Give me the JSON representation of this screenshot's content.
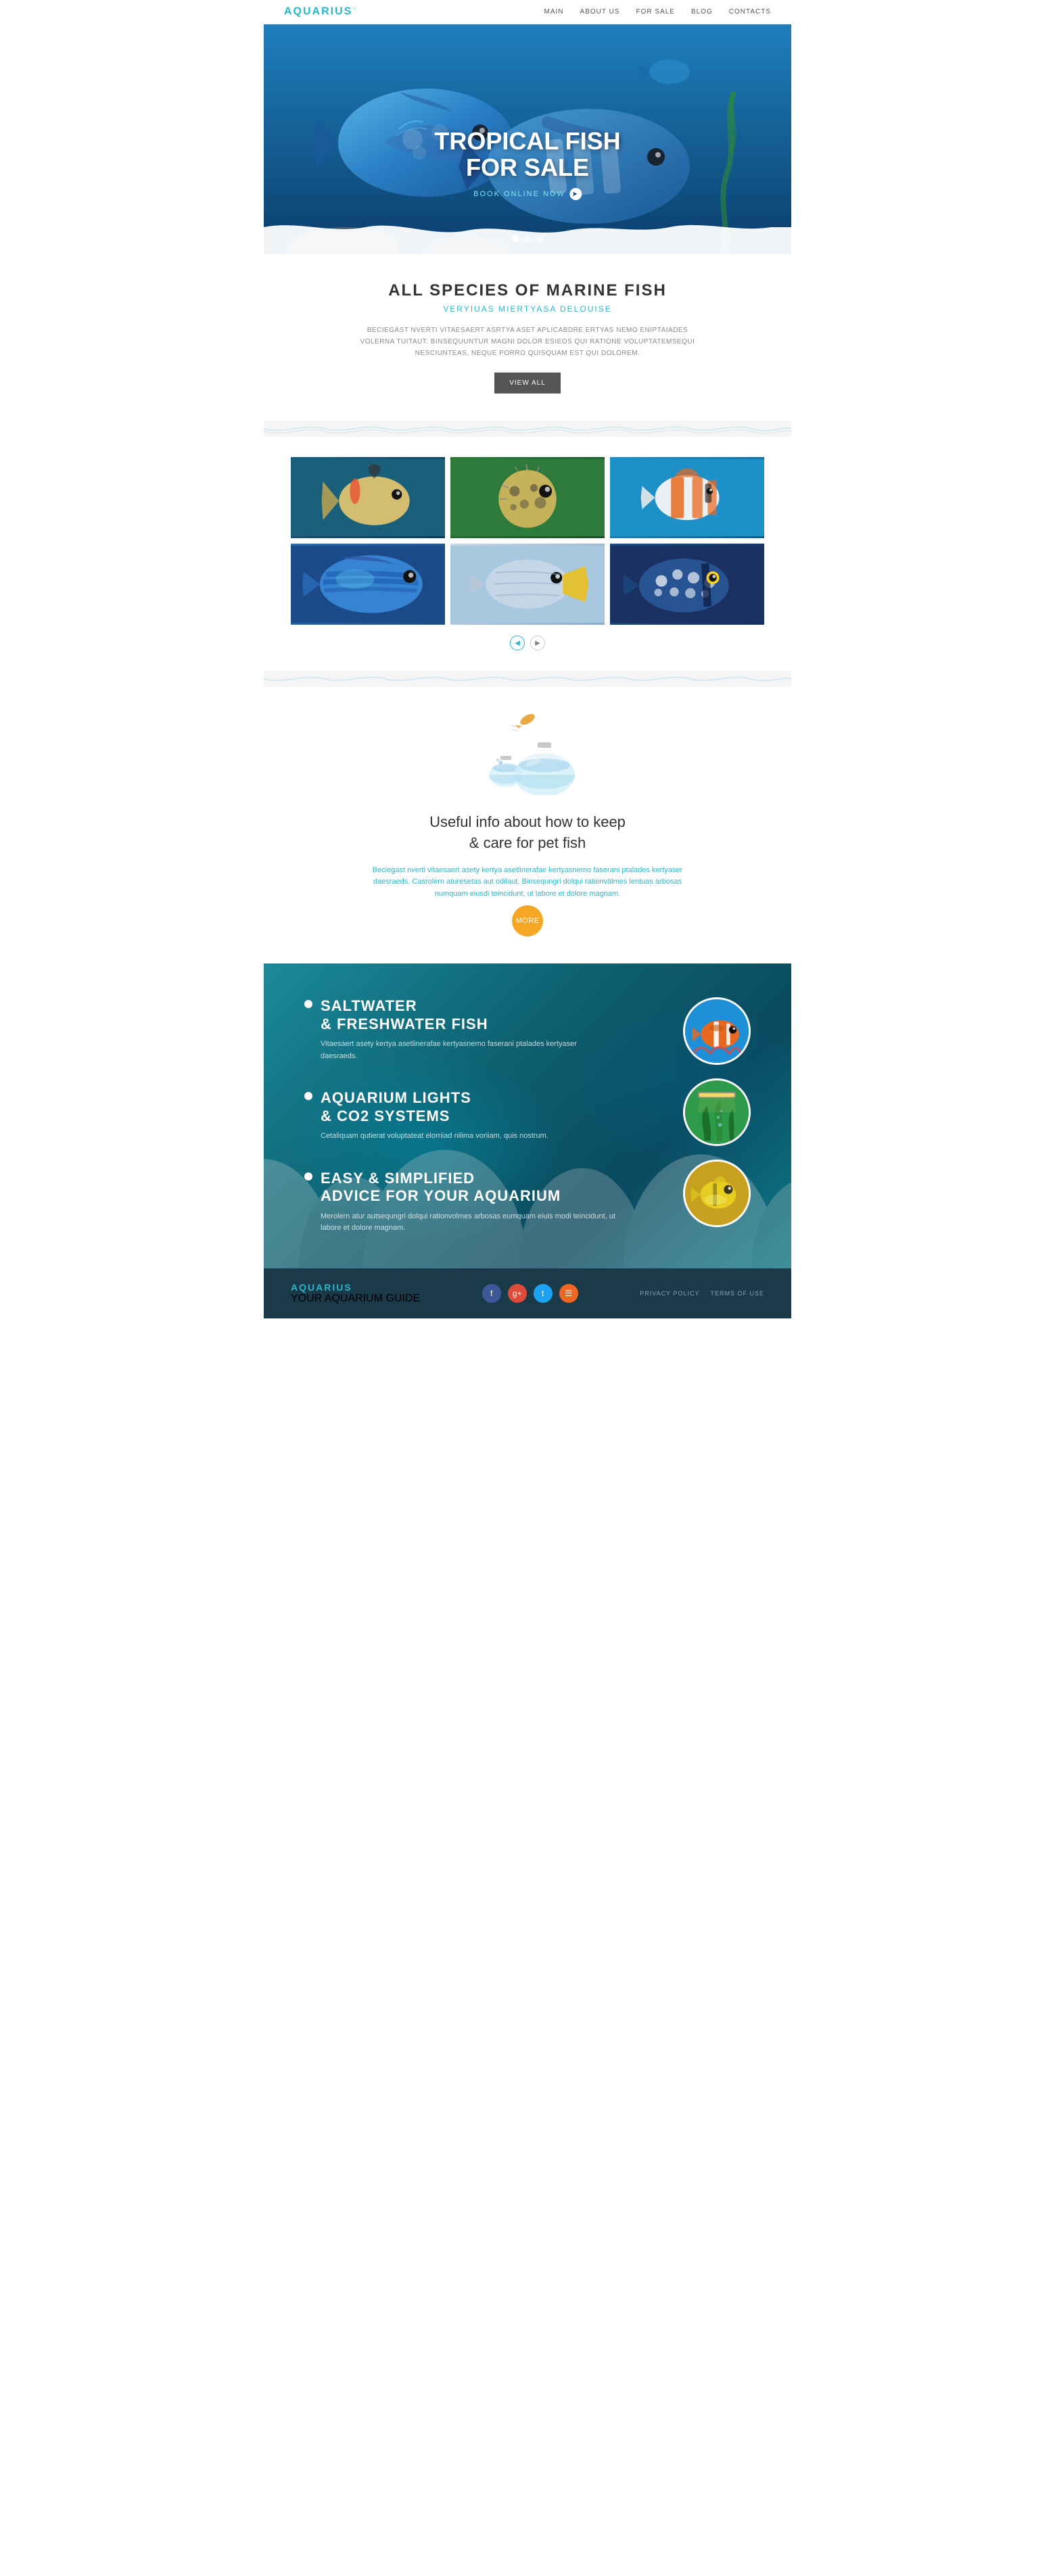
{
  "header": {
    "logo": "AQUARIUS",
    "nav": [
      {
        "label": "MAIN",
        "href": "#"
      },
      {
        "label": "ABOUT US",
        "href": "#"
      },
      {
        "label": "FOR SALE",
        "href": "#"
      },
      {
        "label": "BLOG",
        "href": "#"
      },
      {
        "label": "CONTACTS",
        "href": "#"
      }
    ]
  },
  "hero": {
    "title_line1": "TROPICAL FISH",
    "title_line2": "FOR SALE",
    "cta": "BOOK ONLINE NOW",
    "dots": [
      true,
      false,
      false
    ]
  },
  "species": {
    "heading": "ALL SPECIES OF MARINE FISH",
    "subtitle": "VERYIUAS MIERTYASA DELOUISE",
    "body": "BECIEGAST NVERTI VITAESAERT ASRTYA ASET APLICABDRE ERTYAS NEMO ENIPTAIADES VOLERNA TUITAUT. BINSEQUUNTUR MAGNI DOLOR ESIEOS QUI RATIONE VOLUPTATEMSEQUI NESCIUNTEAS, NEQUE PORRO QUISQUAM EST QUI DOLOREM.",
    "view_all_btn": "VIEW ALL"
  },
  "gallery": {
    "fish": [
      {
        "emoji": "🐟",
        "class": "fish1"
      },
      {
        "emoji": "🐡",
        "class": "fish2"
      },
      {
        "emoji": "🐠",
        "class": "fish3"
      },
      {
        "emoji": "🐟",
        "class": "fish4"
      },
      {
        "emoji": "🐟",
        "class": "fish5"
      },
      {
        "emoji": "🐡",
        "class": "fish6"
      }
    ]
  },
  "care": {
    "heading": "Useful info about how to keep\n& care for pet fish",
    "subtitle_text": "Beciegast nverti vitaesaert asety kertya asetlinerafae kertyasnemo faserani ptalades kertyaser daesraeds. Casrolern aturesetas aut odilaut. Binsequngri dolqui rationvälmes lentuas arbosas numquam eiusdi teincidunt, ut labore et dolore magnam.",
    "more_btn": "more"
  },
  "features": {
    "items": [
      {
        "title": "SALTWATER\n& FRESHWATER FISH",
        "desc": "Vitaesaert asety kertya asetlinerafae kertyasnemo faserani ptalades kertyaser daesraeds.",
        "circle_emoji": "🐠",
        "circle_class": "circle1"
      },
      {
        "title": "AQUARIUM LIGHTS\n& CO2 SYSTEMS",
        "desc": "Cetaliquam qutierat voluptateat elorriiad nilima voriiam, quis nostrum.",
        "circle_emoji": "🌿",
        "circle_class": "circle2"
      },
      {
        "title": "EASY & SIMPLIFIED\nADVICE FOR YOUR AQUARIUM",
        "desc": "Merolern atur autsequngri dolqui rationvolmes arbosas eumquam eiuis modi teincidunt, ut labore et dolore magnam.",
        "circle_emoji": "🐟",
        "circle_class": "circle3"
      }
    ]
  },
  "footer": {
    "logo": "AQUARIUS",
    "tagline": "YOUR AQUARIUM GUIDE",
    "social": [
      {
        "icon": "f",
        "label": "facebook",
        "class": "social-fb"
      },
      {
        "icon": "g+",
        "label": "google-plus",
        "class": "social-gp"
      },
      {
        "icon": "t",
        "label": "twitter",
        "class": "social-tw"
      },
      {
        "icon": "rss",
        "label": "rss",
        "class": "social-rss"
      }
    ],
    "links": [
      {
        "label": "PRIVACY POLICY"
      },
      {
        "label": "TERMS OF USE"
      }
    ]
  }
}
